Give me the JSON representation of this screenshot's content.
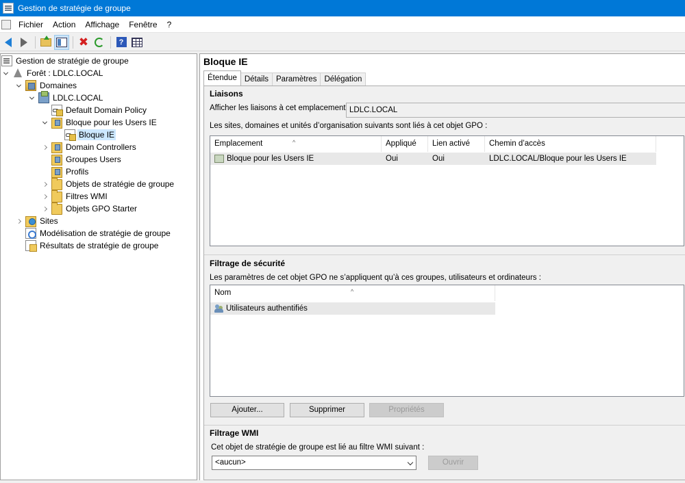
{
  "window": {
    "title": "Gestion de stratégie de groupe"
  },
  "menu": [
    "Fichier",
    "Action",
    "Affichage",
    "Fenêtre",
    "?"
  ],
  "toolbar": [
    "back-icon",
    "forward-icon",
    "folder-up-icon",
    "show-hide-pane-icon",
    "delete-icon",
    "refresh-icon",
    "help-icon",
    "properties-view-icon"
  ],
  "tree": {
    "root": "Gestion de stratégie de groupe",
    "forest": "Forêt : LDLC.LOCAL",
    "domains": "Domaines",
    "domain": "LDLC.LOCAL",
    "default_policy": "Default Domain Policy",
    "ou_bloque": "Bloque pour les Users IE",
    "gpo_link": "Bloque IE",
    "domain_controllers": "Domain Controllers",
    "groupes_users": "Groupes Users",
    "profils": "Profils",
    "gpo_objects": "Objets de stratégie de groupe",
    "wmi_filters": "Filtres WMI",
    "starter_gpos": "Objets GPO Starter",
    "sites": "Sites",
    "modeling": "Modélisation de stratégie de groupe",
    "results": "Résultats de stratégie de groupe"
  },
  "details": {
    "title": "Bloque IE",
    "tabs": [
      "Étendue",
      "Détails",
      "Paramètres",
      "Délégation"
    ],
    "active_tab": "Étendue",
    "links": {
      "section": "Liaisons",
      "location_label": "Afficher les liaisons à cet emplacement :",
      "location_value": "LDLC.LOCAL",
      "description": "Les sites, domaines et unités d’organisation suivants sont liés à cet objet GPO :",
      "columns": [
        "Emplacement",
        "Appliqué",
        "Lien activé",
        "Chemin d’accès"
      ],
      "rows": [
        {
          "location": "Bloque pour les Users IE",
          "enforced": "Oui",
          "enabled": "Oui",
          "path": "LDLC.LOCAL/Bloque pour les Users IE"
        }
      ]
    },
    "security": {
      "section": "Filtrage de sécurité",
      "description": "Les paramètres de cet objet GPO ne s’appliquent qu’à ces groupes, utilisateurs et ordinateurs :",
      "columns": [
        "Nom"
      ],
      "rows": [
        "Utilisateurs authentifiés"
      ],
      "buttons": {
        "add": "Ajouter...",
        "remove": "Supprimer",
        "properties": "Propriétés"
      }
    },
    "wmi": {
      "section": "Filtrage WMI",
      "description": "Cet objet de stratégie de groupe est lié au filtre WMI suivant :",
      "value": "<aucun>",
      "open": "Ouvrir"
    }
  },
  "colors": {
    "titlebar": "#0078d7",
    "selection": "#cce8ff"
  }
}
